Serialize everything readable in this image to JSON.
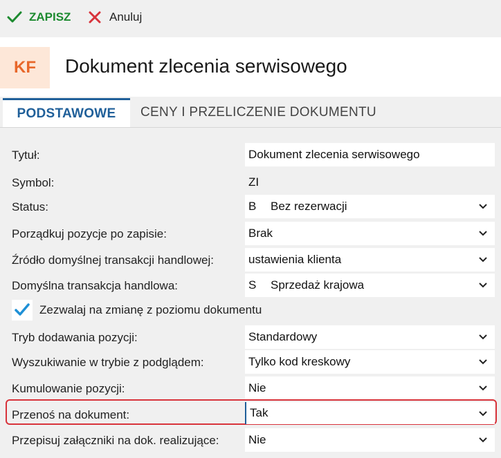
{
  "toolbar": {
    "save_label": "ZAPISZ",
    "cancel_label": "Anuluj"
  },
  "header": {
    "avatar_text": "KF",
    "title": "Dokument zlecenia serwisowego"
  },
  "tabs": [
    {
      "label": "PODSTAWOWE",
      "active": true
    },
    {
      "label": "CENY I PRZELICZENIE DOKUMENTU",
      "active": false
    }
  ],
  "form": {
    "title": {
      "label": "Tytuł:",
      "value": "Dokument zlecenia serwisowego"
    },
    "symbol": {
      "label": "Symbol:",
      "value": "ZI"
    },
    "status": {
      "label": "Status:",
      "code": "B",
      "value": "Bez rezerwacji"
    },
    "order_after_save": {
      "label": "Porządkuj pozycje po zapisie:",
      "value": "Brak"
    },
    "default_transaction_source": {
      "label": "Źródło domyślnej transakcji handlowej:",
      "value": "ustawienia klienta"
    },
    "default_transaction": {
      "label": "Domyślna transakcja handlowa:",
      "code": "S",
      "value": "Sprzedaż krajowa"
    },
    "allow_change": {
      "label": "Zezwalaj na zmianę z poziomu dokumentu",
      "checked": true
    },
    "add_mode": {
      "label": "Tryb dodawania pozycji:",
      "value": "Standardowy"
    },
    "search_preview": {
      "label": "Wyszukiwanie w trybie z podglądem:",
      "value": "Tylko kod kreskowy"
    },
    "accumulate": {
      "label": "Kumulowanie pozycji:",
      "value": "Nie"
    },
    "transfer_to_doc": {
      "label": "Przenoś na dokument:",
      "value": "Tak"
    },
    "copy_attachments": {
      "label": "Przepisuj załączniki na dok. realizujące:",
      "value": "Nie"
    }
  },
  "colors": {
    "accent": "#1f5f99",
    "save_green": "#1c8a2f",
    "cancel_red": "#d8333b",
    "avatar_bg": "#fde7d8",
    "avatar_fg": "#e8672a",
    "highlight": "#d8333b"
  },
  "icons": {
    "save": "check-icon",
    "cancel": "close-icon",
    "dropdown": "chevron-down-icon",
    "checkbox": "checkmark-icon"
  }
}
